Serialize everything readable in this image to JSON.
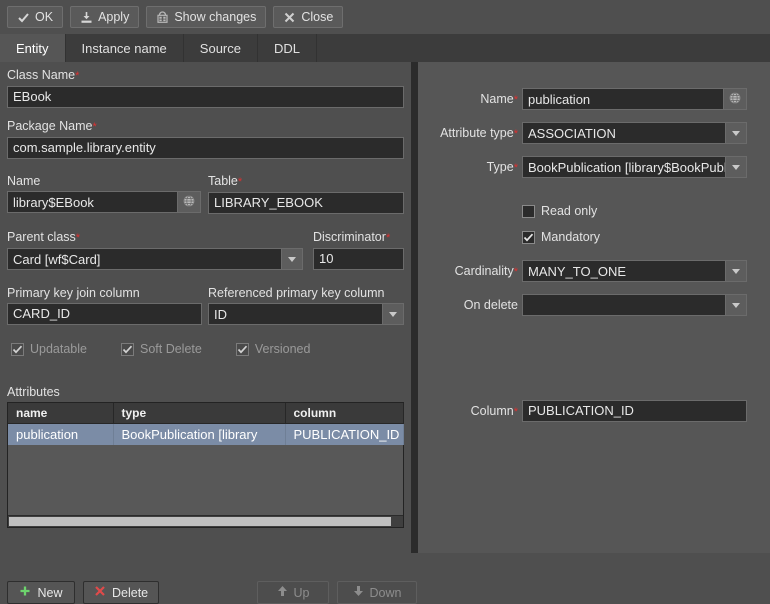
{
  "toolbar": {
    "buttons": [
      {
        "label": "OK",
        "icon": "check-icon"
      },
      {
        "label": "Apply",
        "icon": "save-download-icon"
      },
      {
        "label": "Show changes",
        "icon": "diff-compare-icon"
      },
      {
        "label": "Close",
        "icon": "close-x-icon"
      }
    ]
  },
  "tabs": [
    {
      "label": "Entity",
      "active": true
    },
    {
      "label": "Instance name",
      "active": false
    },
    {
      "label": "Source",
      "active": false
    },
    {
      "label": "DDL",
      "active": false
    }
  ],
  "entity": {
    "class_name": {
      "label": "Class Name",
      "required": true,
      "value": "EBook"
    },
    "package_name": {
      "label": "Package Name",
      "required": true,
      "value": "com.sample.library.entity"
    },
    "name": {
      "label": "Name",
      "required": false,
      "value": "library$EBook",
      "icon": "globe-icon"
    },
    "table": {
      "label": "Table",
      "required": true,
      "value": "LIBRARY_EBOOK"
    },
    "parent_class": {
      "label": "Parent class",
      "required": true,
      "value": "Card [wf$Card]"
    },
    "discriminator": {
      "label": "Discriminator",
      "required": true,
      "value": "10"
    },
    "primary_key_join_column": {
      "label": "Primary key join column",
      "required": false,
      "value": "CARD_ID"
    },
    "referenced_primary_key_column": {
      "label": "Referenced primary key column",
      "required": false,
      "value": "ID"
    },
    "flags": [
      {
        "label": "Updatable",
        "checked": true,
        "disabled": true
      },
      {
        "label": "Soft Delete",
        "checked": true,
        "disabled": true
      },
      {
        "label": "Versioned",
        "checked": true,
        "disabled": true
      }
    ]
  },
  "attributes": {
    "section_label": "Attributes",
    "columns": [
      "name",
      "type",
      "column"
    ],
    "rows": [
      {
        "name": "publication",
        "type": "BookPublication [library",
        "column": "PUBLICATION_ID",
        "selected": true
      }
    ],
    "buttons": {
      "new": {
        "label": "New",
        "icon": "plus-icon",
        "enabled": true
      },
      "delete": {
        "label": "Delete",
        "icon": "cross-icon",
        "enabled": true
      },
      "up": {
        "label": "Up",
        "icon": "arrow-up-icon",
        "enabled": false
      },
      "down": {
        "label": "Down",
        "icon": "arrow-down-icon",
        "enabled": false
      }
    }
  },
  "attribute_detail": {
    "name": {
      "label": "Name",
      "required": true,
      "value": "publication",
      "icon": "globe-icon"
    },
    "attribute_type": {
      "label": "Attribute type",
      "required": true,
      "value": "ASSOCIATION"
    },
    "type": {
      "label": "Type",
      "required": true,
      "value": "BookPublication [library$BookPublic"
    },
    "read_only": {
      "label": "Read only",
      "checked": false
    },
    "mandatory": {
      "label": "Mandatory",
      "checked": true
    },
    "cardinality": {
      "label": "Cardinality",
      "required": true,
      "value": "MANY_TO_ONE"
    },
    "on_delete": {
      "label": "On delete",
      "required": false,
      "value": ""
    },
    "column": {
      "label": "Column",
      "required": true,
      "value": "PUBLICATION_ID"
    }
  },
  "colors": {
    "window_bg": "#4f4f4f",
    "right_panel_bg": "#565656",
    "field_bg": "#2b2b2b",
    "required_marker": "#e03030",
    "row_selection": "#7b8ca6",
    "accent_green": "#6dd46d",
    "accent_red": "#e04a4a"
  }
}
